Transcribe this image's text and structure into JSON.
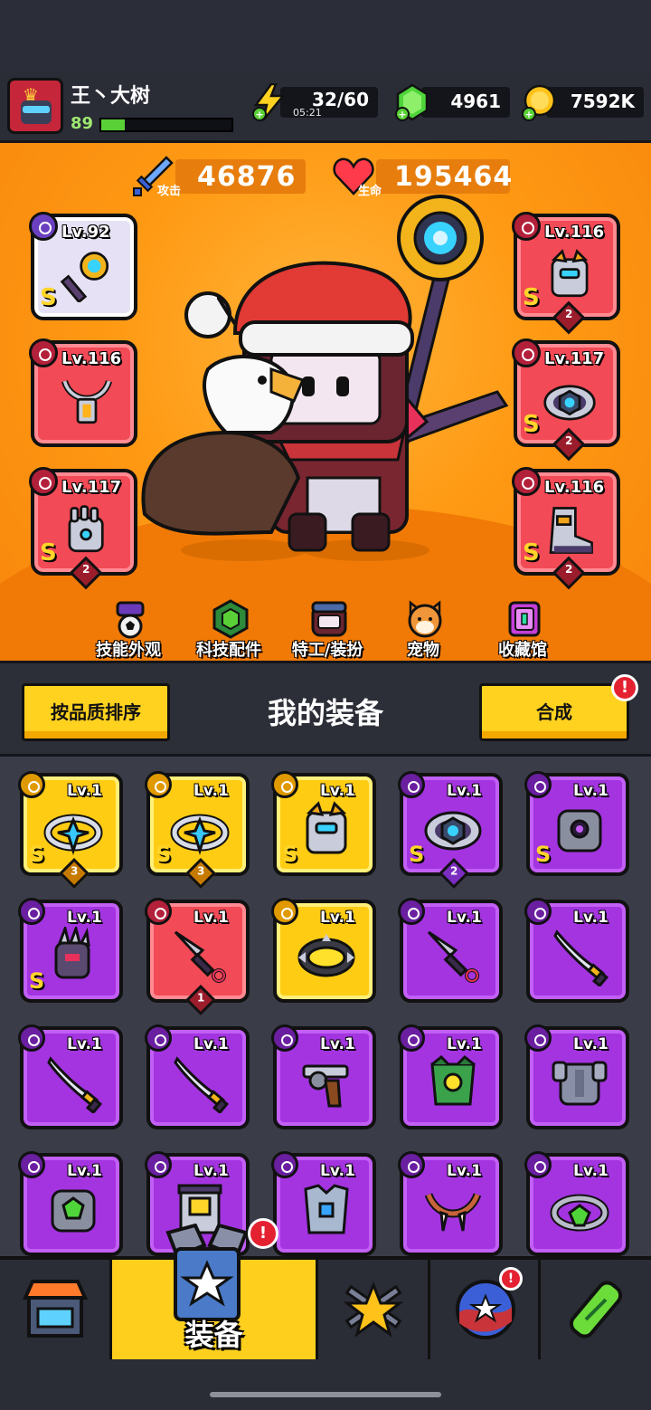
{
  "player": {
    "name": "王丶大树",
    "level": "89",
    "xp_fraction": 0.18
  },
  "resources": {
    "energy": {
      "value": "32/60",
      "timer": "05:21",
      "icon": "lightning-icon"
    },
    "gems": {
      "value": "4961",
      "icon": "green-gem-icon"
    },
    "coins": {
      "value": "7592K",
      "icon": "gold-coin-icon"
    }
  },
  "stats": {
    "attack": {
      "value": "46876",
      "label": "攻击"
    },
    "health": {
      "value": "195464",
      "label": "生命"
    }
  },
  "equipped_slots": [
    {
      "level": "Lv.92",
      "grade": "S",
      "stars": "",
      "color": "silver",
      "type": "weapon",
      "icon": "gear-staff-icon"
    },
    {
      "level": "Lv.116",
      "grade": "",
      "stars": "",
      "color": "red",
      "type": "necklace",
      "icon": "lantern-necklace-icon"
    },
    {
      "level": "Lv.117",
      "grade": "S",
      "stars": "2",
      "color": "red",
      "type": "glove",
      "icon": "mech-glove-icon"
    },
    {
      "level": "Lv.116",
      "grade": "S",
      "stars": "2",
      "color": "red",
      "type": "armor",
      "icon": "mech-armor-icon"
    },
    {
      "level": "Lv.117",
      "grade": "S",
      "stars": "2",
      "color": "red",
      "type": "belt",
      "icon": "hex-belt-icon"
    },
    {
      "level": "Lv.116",
      "grade": "S",
      "stars": "2",
      "color": "red",
      "type": "boots",
      "icon": "mech-boot-icon"
    }
  ],
  "hero_nav": [
    {
      "label": "技能外观",
      "icon": "skill-skin-icon"
    },
    {
      "label": "科技配件",
      "icon": "tech-part-icon"
    },
    {
      "label": "特工/装扮",
      "icon": "agent-costume-icon"
    },
    {
      "label": "宠物",
      "icon": "pet-dog-icon"
    },
    {
      "label": "收藏馆",
      "icon": "collection-icon"
    }
  ],
  "equipment_bar": {
    "sort_label": "按品质排序",
    "title": "我的装备",
    "merge_label": "合成",
    "merge_alert": "!"
  },
  "inventory": [
    {
      "level": "Lv.1",
      "grade": "S",
      "stars": "3",
      "color": "gold",
      "icon": "star-ring-icon"
    },
    {
      "level": "Lv.1",
      "grade": "S",
      "stars": "3",
      "color": "gold",
      "icon": "star-ring-icon"
    },
    {
      "level": "Lv.1",
      "grade": "S",
      "stars": "",
      "color": "gold",
      "icon": "mech-armor-icon"
    },
    {
      "level": "Lv.1",
      "grade": "S",
      "stars": "2",
      "color": "purple",
      "icon": "hex-belt-icon"
    },
    {
      "level": "Lv.1",
      "grade": "S",
      "stars": "",
      "color": "purple",
      "icon": "stone-armor-icon"
    },
    {
      "level": "Lv.1",
      "grade": "S",
      "stars": "",
      "color": "purple",
      "icon": "claw-glove-icon"
    },
    {
      "level": "Lv.1",
      "grade": "",
      "stars": "1",
      "color": "red",
      "icon": "kunai-icon"
    },
    {
      "level": "Lv.1",
      "grade": "",
      "stars": "",
      "color": "gold",
      "icon": "spiked-belt-icon"
    },
    {
      "level": "Lv.1",
      "grade": "",
      "stars": "",
      "color": "purple",
      "icon": "kunai-icon"
    },
    {
      "level": "Lv.1",
      "grade": "",
      "stars": "",
      "color": "purple",
      "icon": "katana-icon"
    },
    {
      "level": "Lv.1",
      "grade": "",
      "stars": "",
      "color": "purple",
      "icon": "katana-icon"
    },
    {
      "level": "Lv.1",
      "grade": "",
      "stars": "",
      "color": "purple",
      "icon": "katana-icon"
    },
    {
      "level": "Lv.1",
      "grade": "",
      "stars": "",
      "color": "purple",
      "icon": "revolver-icon"
    },
    {
      "level": "Lv.1",
      "grade": "",
      "stars": "",
      "color": "purple",
      "icon": "leaf-armor-icon"
    },
    {
      "level": "Lv.1",
      "grade": "",
      "stars": "",
      "color": "purple",
      "icon": "steel-armor-icon"
    },
    {
      "level": "Lv.1",
      "grade": "",
      "stars": "",
      "color": "purple",
      "icon": "gem-armor-icon"
    },
    {
      "level": "Lv.1",
      "grade": "",
      "stars": "",
      "color": "purple",
      "icon": "robot-armor-icon"
    },
    {
      "level": "Lv.1",
      "grade": "",
      "stars": "",
      "color": "purple",
      "icon": "vest-armor-icon"
    },
    {
      "level": "Lv.1",
      "grade": "",
      "stars": "",
      "color": "purple",
      "icon": "fang-necklace-icon"
    },
    {
      "level": "Lv.1",
      "grade": "",
      "stars": "",
      "color": "purple",
      "icon": "gem-ring-icon"
    }
  ],
  "bottom_nav": [
    {
      "label": "",
      "icon": "shop-icon",
      "active": false
    },
    {
      "label": "装备",
      "icon": "equipment-icon",
      "active": true,
      "alert": "!"
    },
    {
      "label": "",
      "icon": "battle-star-icon",
      "active": false
    },
    {
      "label": "",
      "icon": "star-orb-icon",
      "active": false,
      "alert": "!"
    },
    {
      "label": "",
      "icon": "dna-capsule-icon",
      "active": false
    }
  ],
  "colors": {
    "hero_bg": "#ff9a14",
    "card_purple": "#a334e0",
    "card_gold": "#ffcc14",
    "card_red": "#f24a56",
    "button_yellow": "#ffd21f"
  }
}
